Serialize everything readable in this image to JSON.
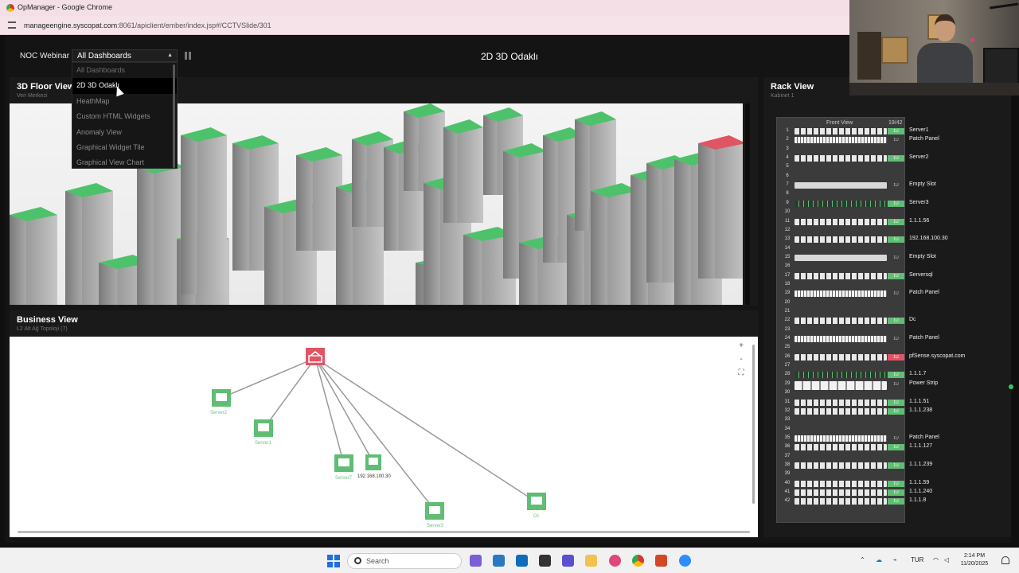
{
  "browser": {
    "window_title": "OpManager - Google Chrome",
    "url_host": "manageengine.syscopat.com",
    "url_path": ":8061/apiclient/ember/index.jsp#/CCTVSlide/301"
  },
  "topbar": {
    "noc_label": "NOC Webinar",
    "selected_dashboard": "All Dashboards",
    "page_title": "2D 3D Odaklı"
  },
  "dropdown": {
    "options": [
      {
        "label": "All Dashboards",
        "state": "dim"
      },
      {
        "label": "2D 3D Odaklı",
        "state": "selected"
      },
      {
        "label": "HeathMap",
        "state": "normal"
      },
      {
        "label": "Custom HTML Widgets",
        "state": "normal"
      },
      {
        "label": "Anomaly View",
        "state": "normal"
      },
      {
        "label": "Graphical Widget Tile",
        "state": "normal"
      },
      {
        "label": "Graphical View Chart",
        "state": "normal"
      }
    ]
  },
  "floor_view": {
    "title": "3D Floor View",
    "subtitle": "Veri Merkezi"
  },
  "business_view": {
    "title": "Business View",
    "subtitle": "L2 Alt Ağ Topoloji (7)",
    "zoom_in": "+",
    "zoom_out": "-",
    "fit": "⛶",
    "nodes": [
      {
        "label": "Server2"
      },
      {
        "label": "Server1"
      },
      {
        "label": "Server7"
      },
      {
        "label": "192.168.100.30"
      },
      {
        "label": "Server3"
      },
      {
        "label": "Dc"
      }
    ]
  },
  "rack_view": {
    "title": "Rack View",
    "subtitle": "Kabinet 1",
    "front_label": "Front View",
    "capacity": "19/42",
    "unit_numbers": [
      "1",
      "2",
      "3",
      "4",
      "5",
      "6",
      "7",
      "8",
      "9",
      "10",
      "11",
      "12",
      "13",
      "14",
      "15",
      "16",
      "17",
      "18",
      "19",
      "20",
      "21",
      "22",
      "23",
      "24",
      "25",
      "26",
      "27",
      "28",
      "29",
      "30",
      "31",
      "32",
      "33",
      "34",
      "35",
      "36",
      "37",
      "38",
      "39",
      "40",
      "41",
      "42"
    ],
    "devices": [
      {
        "u": 1,
        "label": "Server1",
        "type": "srv",
        "badge": "1U",
        "status": "g"
      },
      {
        "u": 2,
        "label": "Patch Panel",
        "type": "pp",
        "badge": "1U",
        "status": "n"
      },
      {
        "u": 4,
        "label": "Server2",
        "type": "srv",
        "badge": "1U",
        "status": "g"
      },
      {
        "u": 7,
        "label": "Empty Slot",
        "type": "empty",
        "badge": "1U",
        "status": "n"
      },
      {
        "u": 9,
        "label": "Server3",
        "type": "sw",
        "badge": "1U",
        "status": "g"
      },
      {
        "u": 11,
        "label": "1.1.1.56",
        "type": "srv",
        "badge": "1U",
        "status": "g"
      },
      {
        "u": 13,
        "label": "192.168.100.30",
        "type": "srv",
        "badge": "1U",
        "status": "g"
      },
      {
        "u": 15,
        "label": "Empty Slot",
        "type": "empty",
        "badge": "1U",
        "status": "n"
      },
      {
        "u": 17,
        "label": "Serversql",
        "type": "srv",
        "badge": "1U",
        "status": "g"
      },
      {
        "u": 19,
        "label": "Patch Panel",
        "type": "pp",
        "badge": "1U",
        "status": "n"
      },
      {
        "u": 22,
        "label": "Dc",
        "type": "srv",
        "badge": "1U",
        "status": "g"
      },
      {
        "u": 24,
        "label": "Patch Panel",
        "type": "pp",
        "badge": "1U",
        "status": "n"
      },
      {
        "u": 26,
        "label": "pfSense.syscopat.com",
        "type": "srv",
        "badge": "1U",
        "status": "r"
      },
      {
        "u": 28,
        "label": "1.1.1.7",
        "type": "sw",
        "badge": "1U",
        "status": "g"
      },
      {
        "u": 29,
        "label": "Power Strip",
        "type": "pw",
        "badge": "1U",
        "status": "n"
      },
      {
        "u": 31,
        "label": "1.1.1.51",
        "type": "srv",
        "badge": "1U",
        "status": "g"
      },
      {
        "u": 32,
        "label": "1.1.1.238",
        "type": "srv",
        "badge": "1U",
        "status": "g"
      },
      {
        "u": 35,
        "label": "Patch Panel",
        "type": "pp",
        "badge": "1U",
        "status": "n"
      },
      {
        "u": 36,
        "label": "1.1.1.127",
        "type": "srv",
        "badge": "1U",
        "status": "g"
      },
      {
        "u": 38,
        "label": "1.1.1.239",
        "type": "srv",
        "badge": "1U",
        "status": "g"
      },
      {
        "u": 40,
        "label": "1.1.1.59",
        "type": "srv",
        "badge": "1U",
        "status": "g"
      },
      {
        "u": 41,
        "label": "1.1.1.240",
        "type": "srv",
        "badge": "1U",
        "status": "g"
      },
      {
        "u": 42,
        "label": "1.1.1.8",
        "type": "srv",
        "badge": "1U",
        "status": "g"
      }
    ]
  },
  "taskbar": {
    "search_placeholder": "Search",
    "language": "TUR",
    "time": "2:14 PM",
    "date": "11/20/2025"
  },
  "colors": {
    "status_ok": "#5fbd74",
    "status_critical": "#e05565",
    "rack_top_green": "#4ec26a"
  }
}
